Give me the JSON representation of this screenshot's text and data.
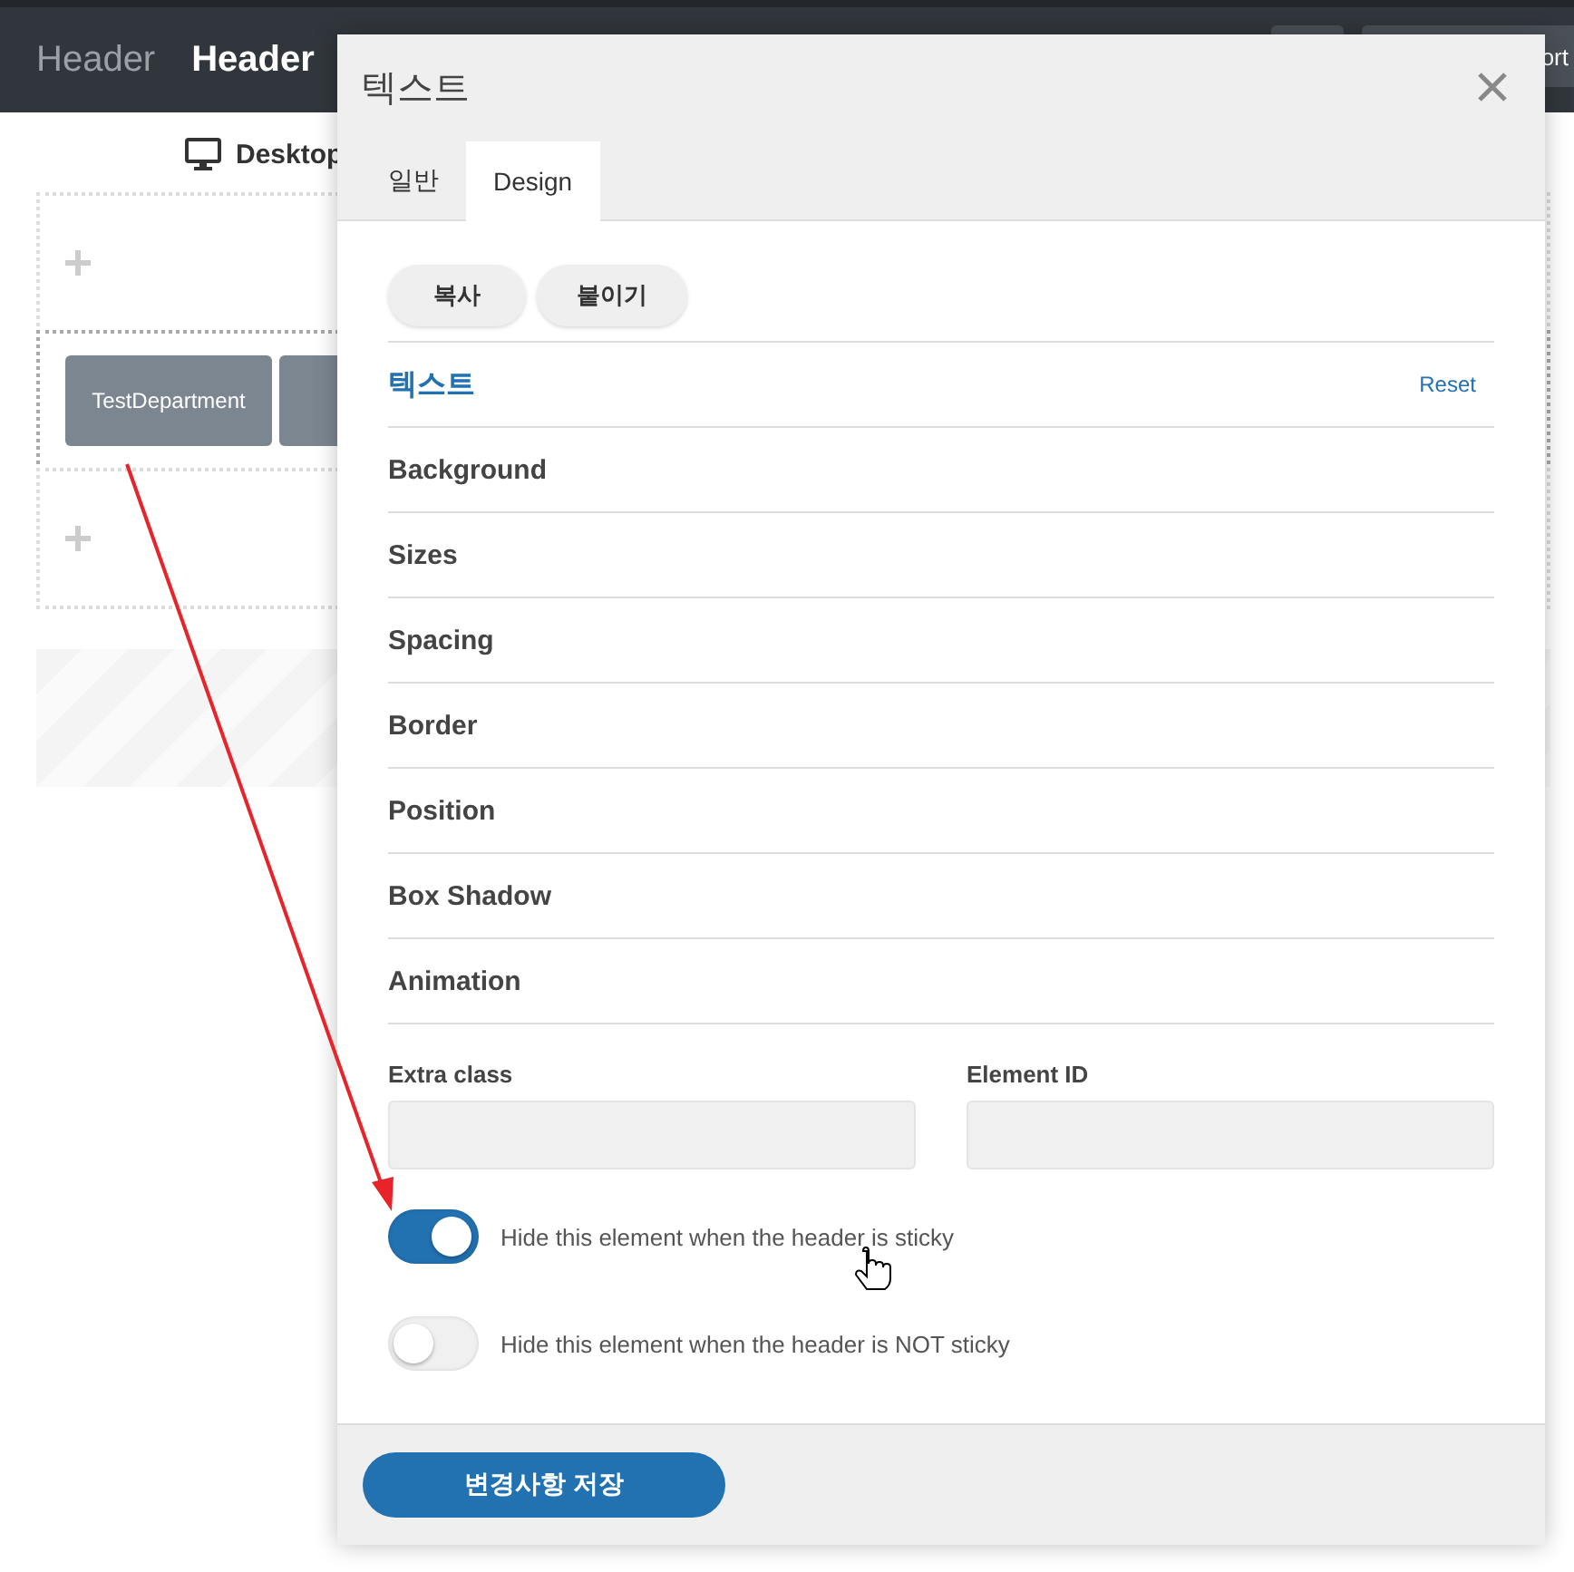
{
  "header": {
    "titles": [
      {
        "label": "Header",
        "selected": false
      },
      {
        "label": "Header",
        "selected": true
      }
    ],
    "button_text": "ort"
  },
  "device": {
    "label": "Desktop"
  },
  "canvas": {
    "rows": [
      {
        "kind": "add"
      },
      {
        "kind": "menu",
        "items": [
          {
            "label": "TestDepartment"
          }
        ]
      },
      {
        "kind": "add"
      }
    ]
  },
  "modal": {
    "title": "텍스트",
    "tabs": [
      {
        "label": "일반",
        "selected": false
      },
      {
        "label": "Design",
        "selected": true
      }
    ],
    "actions": [
      "복사",
      "붙이기"
    ],
    "section_header": {
      "title": "텍스트",
      "reset": "Reset"
    },
    "sections": [
      "Background",
      "Sizes",
      "Spacing",
      "Border",
      "Position",
      "Box Shadow",
      "Animation"
    ],
    "fields": [
      {
        "label": "Extra class"
      },
      {
        "label": "Element ID"
      }
    ],
    "toggles": [
      {
        "label": "Hide this element when the header is sticky",
        "on": true
      },
      {
        "label": "Hide this element when the header is NOT sticky",
        "on": false
      }
    ],
    "save": "변경사항 저장"
  }
}
